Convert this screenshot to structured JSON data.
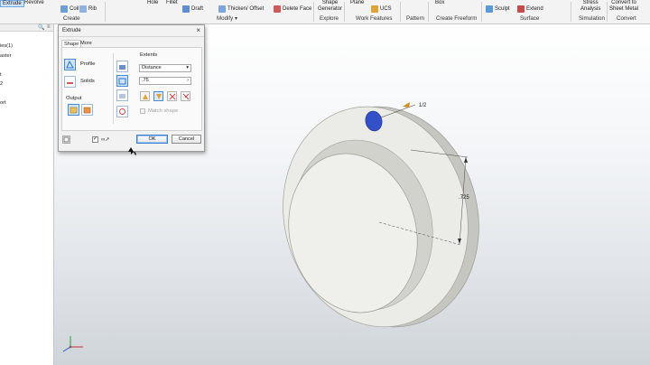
{
  "ribbon": {
    "buttons": {
      "extrude": "Extrude",
      "revolve": "Revolve",
      "coil": "Coil",
      "rib": "Rib",
      "hole": "Hole",
      "fillet": "Fillet",
      "draft": "Draft",
      "thicken_offset": "Thicken/ Offset",
      "delete_face": "Delete Face",
      "shape_generator_1": "Shape",
      "shape_generator_2": "Generator",
      "plane": "Plane",
      "ucs": "UCS",
      "box": "Box",
      "sculpt": "Sculpt",
      "extend": "Extend",
      "stress_1": "Stress",
      "stress_2": "Analysis",
      "convert_1": "Convert to",
      "convert_2": "Sheet Metal"
    },
    "groups": {
      "create": "Create",
      "modify": "Modify ▾",
      "explore": "Explore",
      "work_features": "Work Features",
      "pattern": "Pattern",
      "create_freeform": "Create Freeform",
      "surface": "Surface",
      "simulation": "Simulation",
      "convert": "Convert"
    }
  },
  "browser": {
    "items": [
      "ies(1)",
      "aster",
      "t",
      "2",
      "ort"
    ]
  },
  "dialog": {
    "title": "Extrude",
    "close": "×",
    "tabs": [
      "Shape",
      "More"
    ],
    "profile_label": "Profile",
    "solids_label": "Solids",
    "output_label": "Output",
    "extents_label": "Extents",
    "extents_type": "Distance",
    "distance_value": ".75",
    "match_shape": "Match shape",
    "ok": "OK",
    "cancel": "Cancel"
  },
  "viewport": {
    "dim_label_1": "1/2",
    "dim_label_2": ".725"
  },
  "colors": {
    "accent": "#2f6fce",
    "selected_circle": "#3350c8",
    "part_face": "#eaeae6",
    "part_side": "#c9c9c4"
  }
}
